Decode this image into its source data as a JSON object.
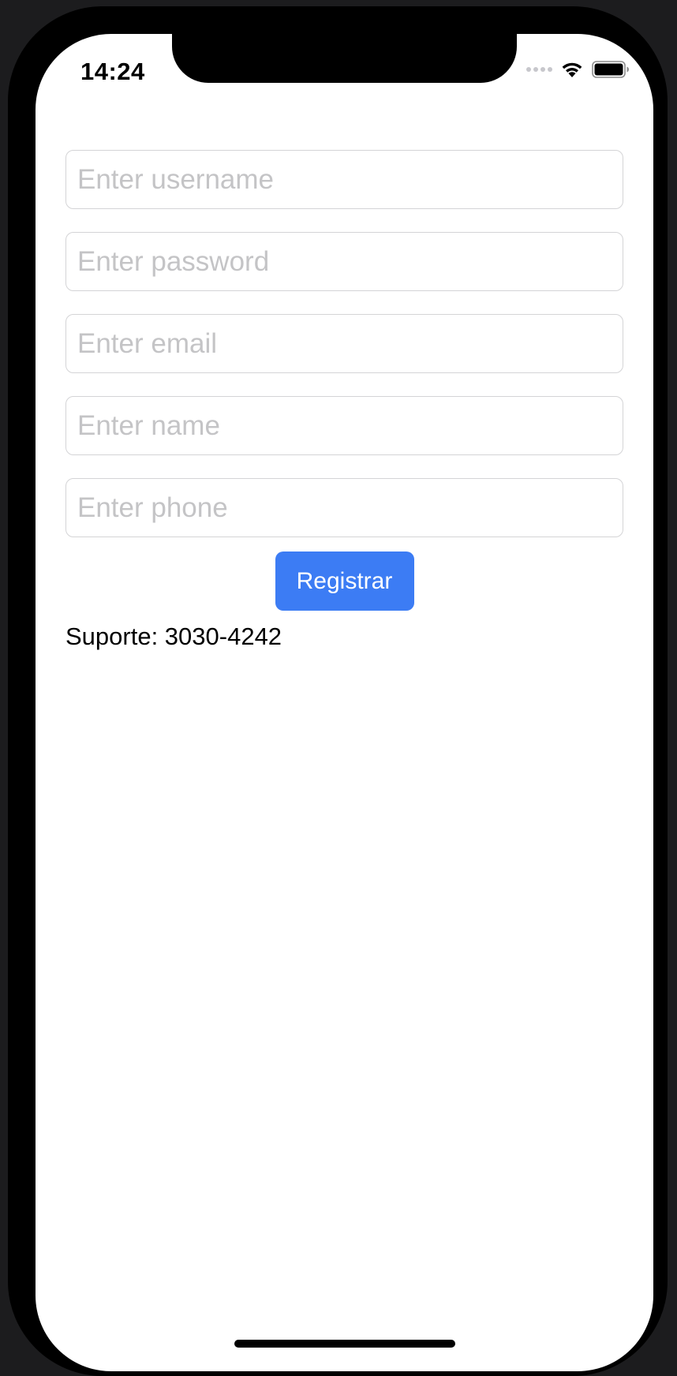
{
  "status_bar": {
    "time": "14:24"
  },
  "form": {
    "username_placeholder": "Enter username",
    "password_placeholder": "Enter password",
    "email_placeholder": "Enter email",
    "name_placeholder": "Enter name",
    "phone_placeholder": "Enter phone",
    "register_label": "Registrar"
  },
  "support_text": "Suporte: 3030-4242",
  "colors": {
    "button_bg": "#3c7cf4",
    "field_border": "#d4d4d6",
    "placeholder": "#c4c4c6"
  }
}
